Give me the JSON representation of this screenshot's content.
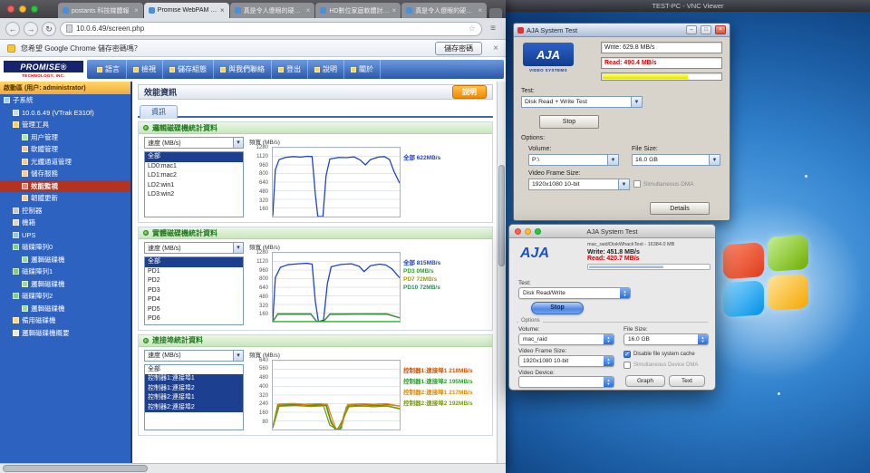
{
  "browser": {
    "tabs": [
      {
        "title": "postants 科技媒體報",
        "active": false
      },
      {
        "title": "Promise WebPAM PROe",
        "active": true
      },
      {
        "title": "真是令人傻眼的硬碟速度!!-Fo...",
        "active": false
      },
      {
        "title": "HD數位家庭軟體討論區--HD.Cl...",
        "active": false
      },
      {
        "title": "真是令人傻眼的硬碟速度!!-H...",
        "active": false
      }
    ],
    "toolbar": {
      "back": "←",
      "forward": "→",
      "refresh": "↻",
      "menu": "≡",
      "star": "☆"
    },
    "url": "10.0.6.49/screen.php",
    "notification": {
      "text": "您希望 Google Chrome 儲存密碼嗎？",
      "save": "儲存密碼",
      "close": "×"
    }
  },
  "vnc": {
    "title": "TEST-PC - VNC Viewer"
  },
  "webpam": {
    "logo": {
      "name": "PROMISE",
      "reg": "®",
      "tagline": "TECHNOLOGY, INC."
    },
    "menu": [
      "語言",
      "檢視",
      "儲存組態",
      "與我們聯絡",
      "登出",
      "說明",
      "關於"
    ],
    "sidebar": {
      "banner": "啟動區 (用户: administrator)",
      "tree": [
        {
          "label": "子系統",
          "depth": 0,
          "icon": "subsystem",
          "selected": false
        },
        {
          "label": "10.0.6.49 (VTrak E310f)",
          "depth": 1,
          "icon": "chassis",
          "selected": false
        },
        {
          "label": "管理工具",
          "depth": 1,
          "icon": "folder",
          "selected": false
        },
        {
          "label": "用户管理",
          "depth": 2,
          "icon": "user",
          "selected": false
        },
        {
          "label": "軟體管理",
          "depth": 2,
          "icon": "tool",
          "selected": false
        },
        {
          "label": "光纖通道管理",
          "depth": 2,
          "icon": "tool",
          "selected": false
        },
        {
          "label": "儲存服務",
          "depth": 2,
          "icon": "tool",
          "selected": false
        },
        {
          "label": "效能監視",
          "depth": 2,
          "icon": "monitor",
          "selected": true
        },
        {
          "label": "韌體更新",
          "depth": 2,
          "icon": "tool",
          "selected": false
        },
        {
          "label": "控制器",
          "depth": 1,
          "icon": "controller",
          "selected": false
        },
        {
          "label": "機箱",
          "depth": 1,
          "icon": "enclosure",
          "selected": false
        },
        {
          "label": "UPS",
          "depth": 1,
          "icon": "ups",
          "selected": false
        },
        {
          "label": "磁碟陣列0",
          "depth": 1,
          "icon": "array",
          "selected": false
        },
        {
          "label": "邏輯磁碟機",
          "depth": 2,
          "icon": "disk",
          "selected": false
        },
        {
          "label": "磁碟陣列1",
          "depth": 1,
          "icon": "array",
          "selected": false
        },
        {
          "label": "邏輯磁碟機",
          "depth": 2,
          "icon": "disk",
          "selected": false
        },
        {
          "label": "磁碟陣列2",
          "depth": 1,
          "icon": "array",
          "selected": false
        },
        {
          "label": "邏輯磁碟機",
          "depth": 2,
          "icon": "disk",
          "selected": false
        },
        {
          "label": "備用磁碟機",
          "depth": 1,
          "icon": "spare",
          "selected": false
        },
        {
          "label": "邏輯磁碟機概要",
          "depth": 1,
          "icon": "summary",
          "selected": false
        }
      ]
    },
    "content": {
      "title": "效能資訊",
      "help": "說明",
      "tab": "資訊",
      "sections": [
        {
          "header": "邏輯磁碟機統計資料",
          "dropdown": "速度 (MB/s)",
          "chart_label": "頻寬 (MB/s)",
          "list": [
            {
              "label": "全部",
              "selected": true
            },
            {
              "label": "LD0:mac1",
              "selected": false
            },
            {
              "label": "LD1:mac2",
              "selected": false
            },
            {
              "label": "LD2:win1",
              "selected": false
            },
            {
              "label": "LD3:win2",
              "selected": false
            }
          ],
          "legend": [
            {
              "label": "全部",
              "value": "622MB/s",
              "color": "#1f43cc"
            }
          ]
        },
        {
          "header": "實體磁碟機統計資料",
          "dropdown": "速度 (MB/s)",
          "chart_label": "頻寬 (MB/s)",
          "list": [
            {
              "label": "全部",
              "selected": true
            },
            {
              "label": "PD1",
              "selected": false
            },
            {
              "label": "PD2",
              "selected": false
            },
            {
              "label": "PD3",
              "selected": false
            },
            {
              "label": "PD4",
              "selected": false
            },
            {
              "label": "PD5",
              "selected": false
            },
            {
              "label": "PD6",
              "selected": false
            }
          ],
          "legend": [
            {
              "label": "全部",
              "value": "815MB/s",
              "color": "#1f43cc"
            },
            {
              "label": "PD3",
              "value": "0MB/s",
              "color": "#2ca02c"
            },
            {
              "label": "PD7",
              "value": "72MB/s",
              "color": "#a0a000"
            },
            {
              "label": "PD10",
              "value": "72MB/s",
              "color": "#2e8b57"
            }
          ]
        },
        {
          "header": "連接埠統計資料",
          "dropdown": "速度 (MB/s)",
          "chart_label": "頻寬 (MB/s)",
          "list": [
            {
              "label": "全部",
              "selected": false
            },
            {
              "label": "控制器1:連接埠1",
              "selected": true
            },
            {
              "label": "控制器1:連接埠2",
              "selected": true
            },
            {
              "label": "控制器2:連接埠1",
              "selected": true
            },
            {
              "label": "控制器2:連接埠2",
              "selected": true
            }
          ],
          "legend": [
            {
              "label": "控制器1:連接埠1",
              "value": "218MB/s",
              "color": "#cc5500"
            },
            {
              "label": "控制器1:連接埠2",
              "value": "195MB/s",
              "color": "#2ca02c"
            },
            {
              "label": "控制器2:連接埠1",
              "value": "217MB/s",
              "color": "#e08a00"
            },
            {
              "label": "控制器2:連接埠2",
              "value": "192MB/s",
              "color": "#7a9a10"
            }
          ]
        }
      ]
    }
  },
  "aja_win": {
    "title": "AJA System Test",
    "logo": "AJA",
    "logo_sub": "VIDEO SYSTEMS",
    "write": "Write: 629.8 MB/s",
    "read": "Read: 490.4 MB/s",
    "test_label": "Test:",
    "test_value": "Disk Read + Write Test",
    "stop": "Stop",
    "options_label": "Options:",
    "volume_label": "Volume:",
    "volume_value": "P:\\",
    "file_label": "File Size:",
    "file_value": "16.0 GB",
    "frame_label": "Video Frame Size:",
    "frame_value": "1920x1080 10-bit",
    "dma": "Simultaneous DMA",
    "details": "Details",
    "min": "–",
    "max": "□",
    "close": "×"
  },
  "aja_mac": {
    "title": "AJA System Test",
    "logo": "AJA",
    "target": "mac_raid/DiskWhackTest - 16384.0 MB",
    "write": "Write: 451.8 MB/s",
    "read": "Read: 420.7 MB/s",
    "test_label": "Test:",
    "test_value": "Disk Read/Write",
    "stop": "Stop",
    "options_label": "Options",
    "volume_label": "Volume:",
    "volume_value": "mac_raid",
    "file_label": "File Size:",
    "file_value": "16.0 GB",
    "frame_label": "Video Frame Size:",
    "frame_value": "1920x1080 10-bit",
    "cache": "Disable file system cache",
    "dma": "Simultaneous Device DMA",
    "video_device_label": "Video Device:",
    "video_device_value": "",
    "graph": "Graph",
    "text": "Text",
    "check": "✓"
  },
  "chart_data": [
    {
      "type": "line",
      "title": "邏輯磁碟機統計資料",
      "xlabel": "",
      "ylabel": "頻寬 (MB/s)",
      "ylim": [
        0,
        1280
      ],
      "ymax": 1280,
      "yticks": [
        1280,
        1120,
        960,
        800,
        640,
        480,
        320,
        160
      ],
      "series": [
        {
          "name": "全部",
          "color": "#1f43cc",
          "points": [
            [
              0,
              10
            ],
            [
              0.02,
              870
            ],
            [
              0.05,
              1060
            ],
            [
              0.1,
              1100
            ],
            [
              0.16,
              1115
            ],
            [
              0.22,
              1105
            ],
            [
              0.27,
              1120
            ],
            [
              0.31,
              1115
            ],
            [
              0.335,
              420
            ],
            [
              0.355,
              0
            ],
            [
              0.395,
              0
            ],
            [
              0.42,
              760
            ],
            [
              0.45,
              1070
            ],
            [
              0.52,
              1100
            ],
            [
              0.58,
              1095
            ],
            [
              0.64,
              1110
            ],
            [
              0.69,
              1050
            ],
            [
              0.73,
              960
            ],
            [
              0.77,
              1060
            ],
            [
              0.83,
              1105
            ],
            [
              0.88,
              1115
            ],
            [
              0.92,
              1060
            ],
            [
              0.955,
              840
            ],
            [
              1,
              622
            ]
          ]
        }
      ]
    },
    {
      "type": "line",
      "title": "實體磁碟機統計資料",
      "xlabel": "",
      "ylabel": "頻寬 (MB/s)",
      "ylim": [
        0,
        1280
      ],
      "ymax": 1280,
      "yticks": [
        1280,
        1120,
        960,
        800,
        640,
        480,
        320,
        160
      ],
      "series": [
        {
          "name": "全部",
          "color": "#1f43cc",
          "points": [
            [
              0,
              10
            ],
            [
              0.02,
              820
            ],
            [
              0.06,
              1010
            ],
            [
              0.12,
              1060
            ],
            [
              0.2,
              1075
            ],
            [
              0.27,
              1085
            ],
            [
              0.31,
              1070
            ],
            [
              0.335,
              380
            ],
            [
              0.36,
              0
            ],
            [
              0.4,
              30
            ],
            [
              0.43,
              700
            ],
            [
              0.46,
              1020
            ],
            [
              0.54,
              1065
            ],
            [
              0.62,
              1075
            ],
            [
              0.68,
              1030
            ],
            [
              0.72,
              930
            ],
            [
              0.77,
              1040
            ],
            [
              0.84,
              1070
            ],
            [
              0.89,
              1055
            ],
            [
              0.94,
              980
            ],
            [
              1,
              815
            ]
          ]
        },
        {
          "name": "PD7",
          "color": "#a0a000",
          "points": [
            [
              0,
              5
            ],
            [
              0.04,
              148
            ],
            [
              0.3,
              150
            ],
            [
              0.345,
              8
            ],
            [
              0.4,
              6
            ],
            [
              0.45,
              146
            ],
            [
              0.7,
              150
            ],
            [
              0.9,
              148
            ],
            [
              1,
              72
            ]
          ]
        },
        {
          "name": "PD10",
          "color": "#2e8b57",
          "points": [
            [
              0,
              5
            ],
            [
              0.04,
              138
            ],
            [
              0.3,
              140
            ],
            [
              0.345,
              5
            ],
            [
              0.4,
              4
            ],
            [
              0.45,
              136
            ],
            [
              0.7,
              140
            ],
            [
              0.9,
              138
            ],
            [
              1,
              72
            ]
          ]
        },
        {
          "name": "PD3",
          "color": "#2ca02c",
          "points": [
            [
              0,
              2
            ],
            [
              1,
              2
            ]
          ]
        }
      ]
    },
    {
      "type": "line",
      "title": "連接埠統計資料",
      "xlabel": "",
      "ylabel": "頻寬 (MB/s)",
      "ylim": [
        0,
        640
      ],
      "ymax": 640,
      "yticks": [
        640,
        560,
        480,
        400,
        320,
        240,
        160,
        80
      ],
      "series": [
        {
          "name": "控制器1:連接埠1",
          "color": "#cc5500",
          "points": [
            [
              0,
              20
            ],
            [
              0.04,
              232
            ],
            [
              0.12,
              238
            ],
            [
              0.2,
              230
            ],
            [
              0.28,
              236
            ],
            [
              0.36,
              230
            ],
            [
              0.42,
              236
            ],
            [
              0.455,
              90
            ],
            [
              0.49,
              0
            ],
            [
              0.53,
              0
            ],
            [
              0.565,
              150
            ],
            [
              0.6,
              228
            ],
            [
              0.68,
              236
            ],
            [
              0.76,
              230
            ],
            [
              0.84,
              236
            ],
            [
              0.92,
              230
            ],
            [
              1,
              218
            ]
          ]
        },
        {
          "name": "控制器1:連接埠2",
          "color": "#2ca02c",
          "points": [
            [
              0,
              18
            ],
            [
              0.04,
              222
            ],
            [
              0.14,
              228
            ],
            [
              0.24,
              220
            ],
            [
              0.34,
              226
            ],
            [
              0.42,
              222
            ],
            [
              0.46,
              60
            ],
            [
              0.5,
              0
            ],
            [
              0.54,
              10
            ],
            [
              0.58,
              210
            ],
            [
              0.66,
              224
            ],
            [
              0.74,
              218
            ],
            [
              0.82,
              224
            ],
            [
              0.9,
              220
            ],
            [
              1,
              195
            ]
          ]
        },
        {
          "name": "控制器2:連接埠1",
          "color": "#e08a00",
          "points": [
            [
              0,
              22
            ],
            [
              0.05,
              236
            ],
            [
              0.16,
              242
            ],
            [
              0.26,
              234
            ],
            [
              0.36,
              240
            ],
            [
              0.43,
              234
            ],
            [
              0.465,
              110
            ],
            [
              0.5,
              0
            ],
            [
              0.545,
              40
            ],
            [
              0.59,
              232
            ],
            [
              0.7,
              240
            ],
            [
              0.8,
              234
            ],
            [
              0.9,
              240
            ],
            [
              1,
              217
            ]
          ]
        },
        {
          "name": "控制器2:連接埠2",
          "color": "#7a9a10",
          "points": [
            [
              0,
              16
            ],
            [
              0.05,
              216
            ],
            [
              0.18,
              222
            ],
            [
              0.3,
              214
            ],
            [
              0.4,
              220
            ],
            [
              0.45,
              40
            ],
            [
              0.51,
              0
            ],
            [
              0.555,
              100
            ],
            [
              0.6,
              212
            ],
            [
              0.7,
              218
            ],
            [
              0.8,
              212
            ],
            [
              0.9,
              218
            ],
            [
              1,
              192
            ]
          ]
        }
      ]
    }
  ]
}
